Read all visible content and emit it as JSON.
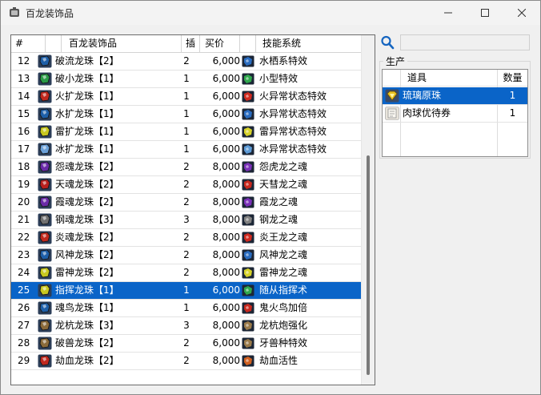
{
  "window": {
    "title": "百龙装饰品"
  },
  "table": {
    "headers": [
      "#",
      "百龙装饰品",
      "插",
      "买价",
      "技能系统"
    ],
    "rows": [
      {
        "num": "12",
        "name": "破流龙珠【2】",
        "slot": "2",
        "price": "6,000",
        "skill": "水栖系特效",
        "gem_color": "#1e5fa8",
        "skill_color": "#2a6cc0"
      },
      {
        "num": "13",
        "name": "破小龙珠【1】",
        "slot": "1",
        "price": "6,000",
        "skill": "小型特效",
        "gem_color": "#2a9a46",
        "skill_color": "#2fa84c"
      },
      {
        "num": "14",
        "name": "火扩龙珠【1】",
        "slot": "1",
        "price": "6,000",
        "skill": "火异常状态特效",
        "gem_color": "#c0281e",
        "skill_color": "#d02a20"
      },
      {
        "num": "15",
        "name": "水扩龙珠【1】",
        "slot": "1",
        "price": "6,000",
        "skill": "水异常状态特效",
        "gem_color": "#1e5fa8",
        "skill_color": "#2a6cc0"
      },
      {
        "num": "16",
        "name": "雷扩龙珠【1】",
        "slot": "1",
        "price": "6,000",
        "skill": "雷异常状态特效",
        "gem_color": "#c8c820",
        "skill_color": "#d6d22a"
      },
      {
        "num": "17",
        "name": "冰扩龙珠【1】",
        "slot": "1",
        "price": "6,000",
        "skill": "冰异常状态特效",
        "gem_color": "#6aa0d8",
        "skill_color": "#5c9ad6"
      },
      {
        "num": "18",
        "name": "怨魂龙珠【2】",
        "slot": "2",
        "price": "8,000",
        "skill": "怨虎龙之魂",
        "gem_color": "#6a2aa8",
        "skill_color": "#7a30b8"
      },
      {
        "num": "19",
        "name": "天魂龙珠【2】",
        "slot": "2",
        "price": "8,000",
        "skill": "天彗龙之魂",
        "gem_color": "#b8201e",
        "skill_color": "#c8281e"
      },
      {
        "num": "20",
        "name": "霞魂龙珠【2】",
        "slot": "2",
        "price": "8,000",
        "skill": "霞龙之魂",
        "gem_color": "#6a2aa8",
        "skill_color": "#7a30b8"
      },
      {
        "num": "21",
        "name": "钢魂龙珠【3】",
        "slot": "3",
        "price": "8,000",
        "skill": "钢龙之魂",
        "gem_color": "#707070",
        "skill_color": "#808080"
      },
      {
        "num": "22",
        "name": "炎魂龙珠【2】",
        "slot": "2",
        "price": "8,000",
        "skill": "炎王龙之魂",
        "gem_color": "#c0281e",
        "skill_color": "#d02a20"
      },
      {
        "num": "23",
        "name": "风神龙珠【2】",
        "slot": "2",
        "price": "8,000",
        "skill": "风神龙之魂",
        "gem_color": "#1e5fa8",
        "skill_color": "#2a6cc0"
      },
      {
        "num": "24",
        "name": "雷神龙珠【2】",
        "slot": "2",
        "price": "8,000",
        "skill": "雷神龙之魂",
        "gem_color": "#c8c820",
        "skill_color": "#d6d22a"
      },
      {
        "num": "25",
        "name": "指挥龙珠【1】",
        "slot": "1",
        "price": "6,000",
        "skill": "随从指挥术",
        "gem_color": "#c8c820",
        "skill_color": "#2fa84c",
        "selected": true
      },
      {
        "num": "26",
        "name": "魂鸟龙珠【1】",
        "slot": "1",
        "price": "6,000",
        "skill": "鬼火鸟加倍",
        "gem_color": "#1e5fa8",
        "skill_color": "#c8281e"
      },
      {
        "num": "27",
        "name": "龙杭龙珠【3】",
        "slot": "3",
        "price": "8,000",
        "skill": "龙杭炮强化",
        "gem_color": "#8a6a3a",
        "skill_color": "#9a7a4a"
      },
      {
        "num": "28",
        "name": "破兽龙珠【2】",
        "slot": "2",
        "price": "6,000",
        "skill": "牙兽种特效",
        "gem_color": "#8a6a3a",
        "skill_color": "#9a7a4a"
      },
      {
        "num": "29",
        "name": "劫血龙珠【2】",
        "slot": "2",
        "price": "8,000",
        "skill": "劫血活性",
        "gem_color": "#c0281e",
        "skill_color": "#d06020"
      }
    ]
  },
  "search": {
    "value": "",
    "placeholder": ""
  },
  "production": {
    "group_label": "生产",
    "headers": [
      "道具",
      "数量"
    ],
    "rows": [
      {
        "name": "琉璃原珠",
        "qty": "1",
        "icon": "gem-icon",
        "selected": true
      },
      {
        "name": "肉球优待券",
        "qty": "1",
        "icon": "ticket-icon",
        "selected": false
      }
    ]
  },
  "colors": {
    "selection": "#0a64c8"
  }
}
